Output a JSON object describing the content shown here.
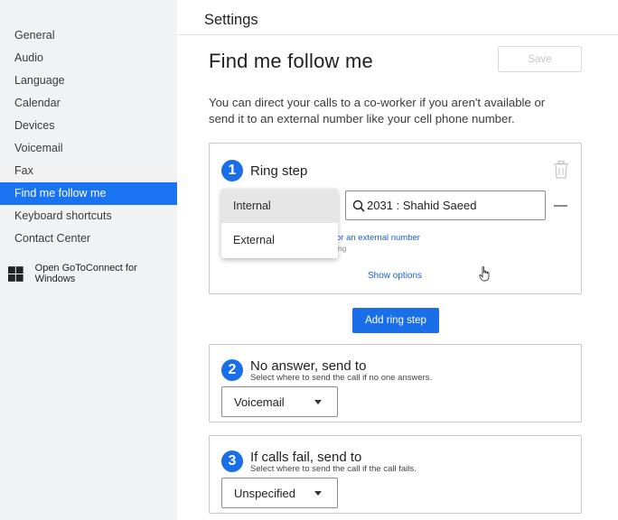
{
  "sidebar": {
    "items": [
      "General",
      "Audio",
      "Language",
      "Calendar",
      "Devices",
      "Voicemail",
      "Fax",
      "Find me follow me",
      "Keyboard shortcuts",
      "Contact Center"
    ],
    "active_index": 7,
    "open_app_label": "Open GoToConnect for Windows"
  },
  "header": {
    "title": "Settings"
  },
  "page": {
    "title": "Find me follow me",
    "save_label": "Save",
    "description": "You can direct your calls to a co-worker if you aren't available or send it to an external number like your cell phone number."
  },
  "ring_step": {
    "number": "1",
    "title": "Ring step",
    "search_value": "2031 : Shahid Saeed",
    "link_text": "or an external number",
    "hint_text": "ing",
    "show_options_label": "Show options",
    "dropdown_options": [
      "Internal",
      "External"
    ],
    "dropdown_selected": "Internal"
  },
  "add_ring_step_label": "Add ring step",
  "no_answer": {
    "number": "2",
    "title": "No answer, send to",
    "subtitle": "Select where to send the call if no one answers.",
    "value": "Voicemail"
  },
  "calls_fail": {
    "number": "3",
    "title": "If calls fail, send to",
    "subtitle": "Select where to send the call if the call fails.",
    "value": "Unspecified"
  },
  "colors": {
    "accent": "#1a6fe8",
    "sidebar_active": "#1a73f0",
    "sidebar_bg": "#f1f2f4"
  }
}
